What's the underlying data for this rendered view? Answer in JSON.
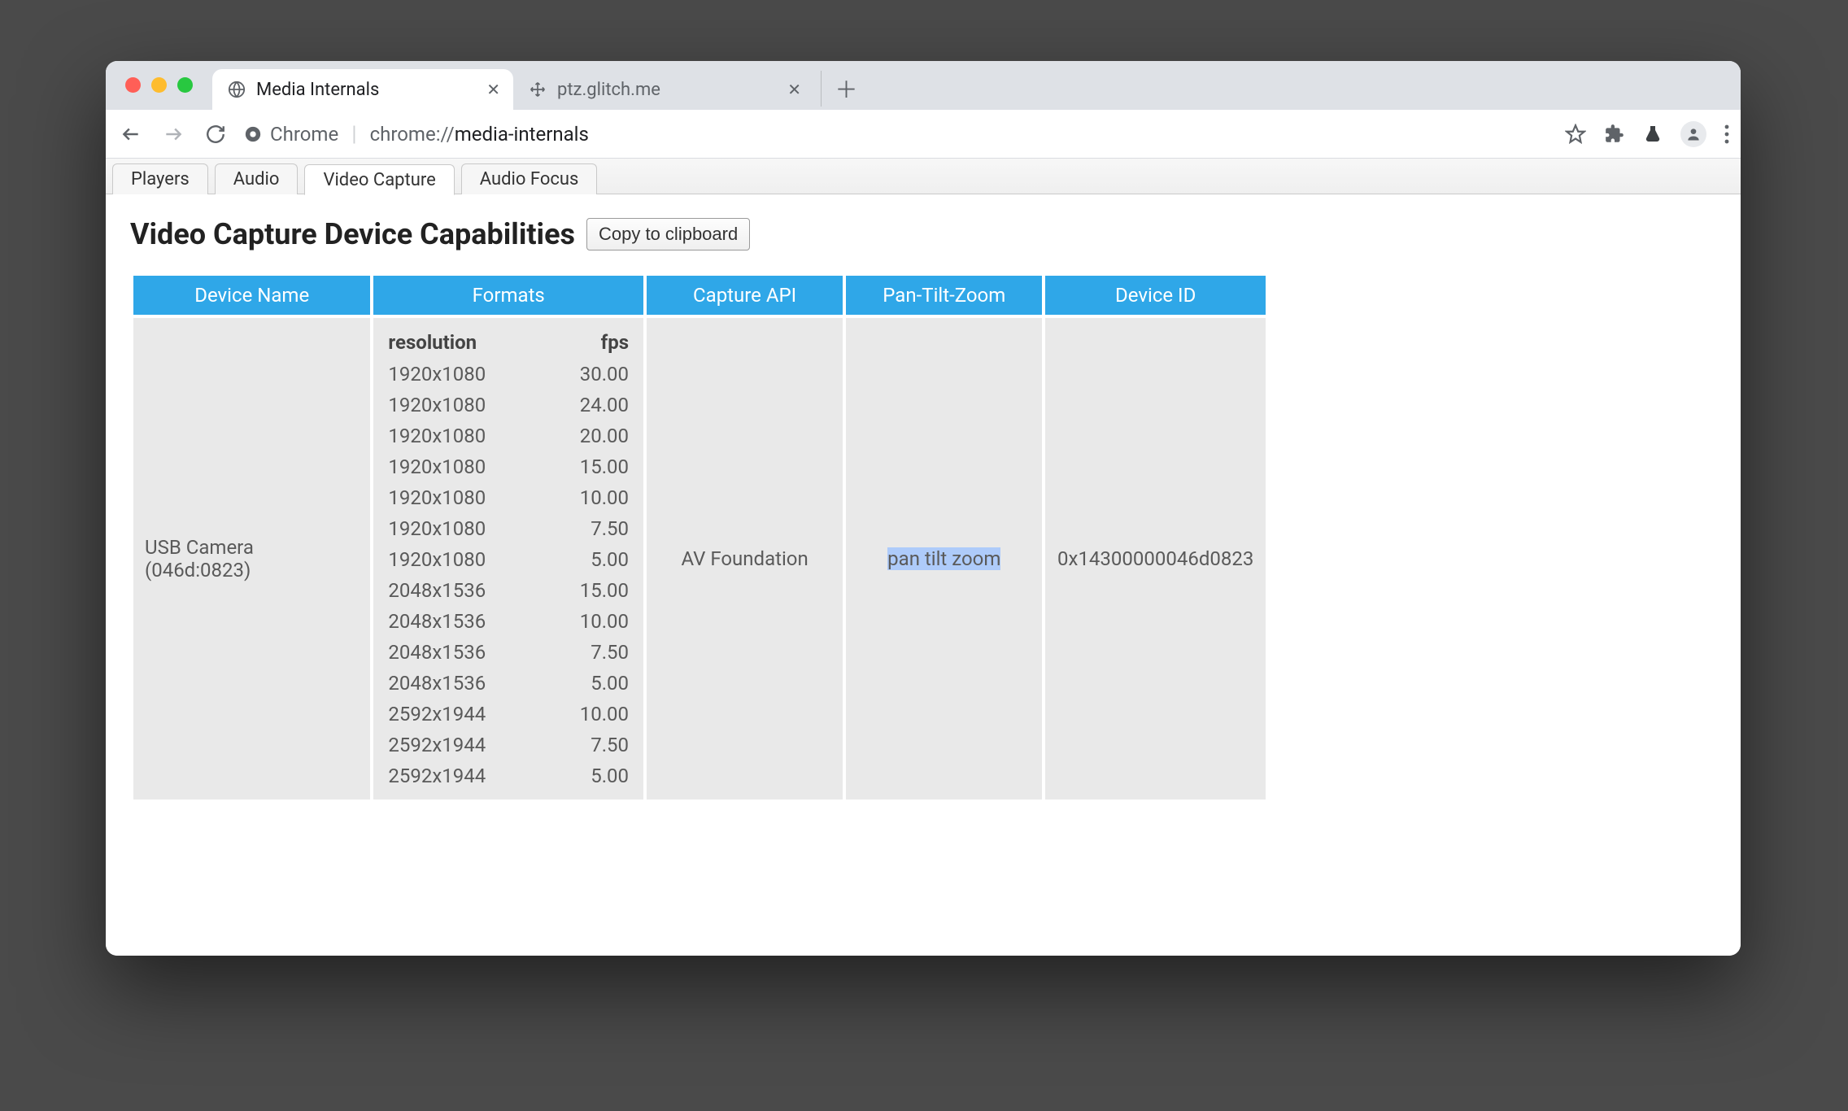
{
  "browser_tabs": [
    {
      "title": "Media Internals",
      "active": true
    },
    {
      "title": "ptz.glitch.me",
      "active": false
    }
  ],
  "omnibox": {
    "chip_label": "Chrome",
    "url_host": "chrome://",
    "url_path": "media-internals"
  },
  "content_tabs": {
    "items": [
      "Players",
      "Audio",
      "Video Capture",
      "Audio Focus"
    ],
    "active_index": 2
  },
  "page": {
    "title": "Video Capture Device Capabilities",
    "copy_button": "Copy to clipboard"
  },
  "table": {
    "headers": [
      "Device Name",
      "Formats",
      "Capture API",
      "Pan-Tilt-Zoom",
      "Device ID"
    ],
    "format_headers": {
      "resolution": "resolution",
      "fps": "fps"
    },
    "rows": [
      {
        "device_name": "USB Camera (046d:0823)",
        "capture_api": "AV Foundation",
        "ptz": "pan tilt zoom",
        "device_id": "0x14300000046d0823",
        "formats": [
          {
            "resolution": "1920x1080",
            "fps": "30.00"
          },
          {
            "resolution": "1920x1080",
            "fps": "24.00"
          },
          {
            "resolution": "1920x1080",
            "fps": "20.00"
          },
          {
            "resolution": "1920x1080",
            "fps": "15.00"
          },
          {
            "resolution": "1920x1080",
            "fps": "10.00"
          },
          {
            "resolution": "1920x1080",
            "fps": "7.50"
          },
          {
            "resolution": "1920x1080",
            "fps": "5.00"
          },
          {
            "resolution": "2048x1536",
            "fps": "15.00"
          },
          {
            "resolution": "2048x1536",
            "fps": "10.00"
          },
          {
            "resolution": "2048x1536",
            "fps": "7.50"
          },
          {
            "resolution": "2048x1536",
            "fps": "5.00"
          },
          {
            "resolution": "2592x1944",
            "fps": "10.00"
          },
          {
            "resolution": "2592x1944",
            "fps": "7.50"
          },
          {
            "resolution": "2592x1944",
            "fps": "5.00"
          }
        ]
      }
    ]
  }
}
